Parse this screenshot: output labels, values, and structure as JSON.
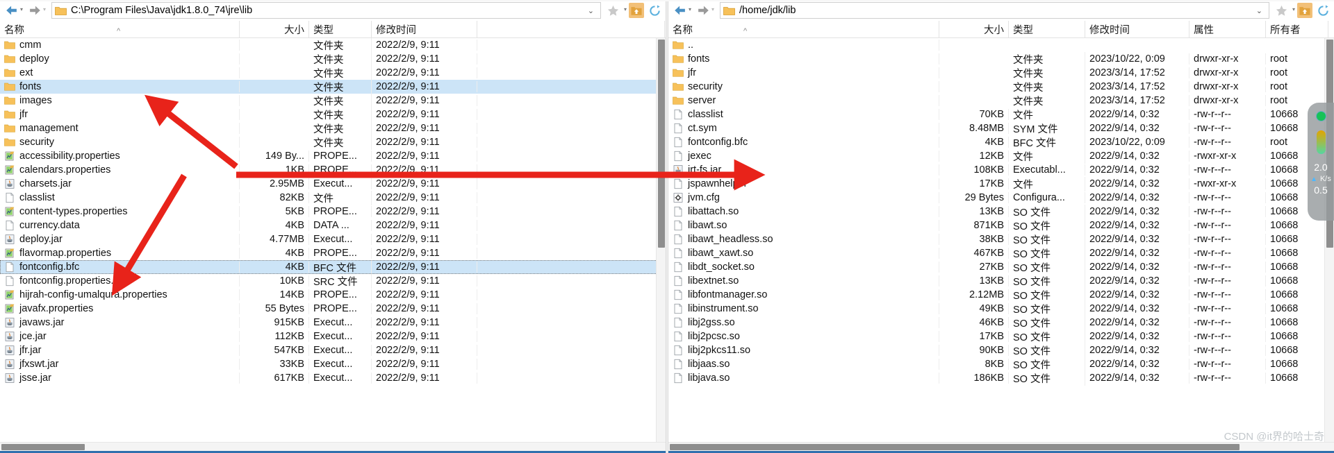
{
  "left": {
    "address": "C:\\Program Files\\Java\\jdk1.8.0_74\\jre\\lib",
    "columns": [
      "名称",
      "大小",
      "类型",
      "修改时间"
    ],
    "rows": [
      {
        "icon": "folder",
        "name": "cmm",
        "size": "",
        "type": "文件夹",
        "time": "2022/2/9, 9:11"
      },
      {
        "icon": "folder",
        "name": "deploy",
        "size": "",
        "type": "文件夹",
        "time": "2022/2/9, 9:11"
      },
      {
        "icon": "folder",
        "name": "ext",
        "size": "",
        "type": "文件夹",
        "time": "2022/2/9, 9:11"
      },
      {
        "icon": "folder",
        "name": "fonts",
        "size": "",
        "type": "文件夹",
        "time": "2022/2/9, 9:11",
        "selected": true
      },
      {
        "icon": "folder",
        "name": "images",
        "size": "",
        "type": "文件夹",
        "time": "2022/2/9, 9:11"
      },
      {
        "icon": "folder",
        "name": "jfr",
        "size": "",
        "type": "文件夹",
        "time": "2022/2/9, 9:11"
      },
      {
        "icon": "folder",
        "name": "management",
        "size": "",
        "type": "文件夹",
        "time": "2022/2/9, 9:11"
      },
      {
        "icon": "folder",
        "name": "security",
        "size": "",
        "type": "文件夹",
        "time": "2022/2/9, 9:11"
      },
      {
        "icon": "properties",
        "name": "accessibility.properties",
        "size": "149 By...",
        "type": "PROPE...",
        "time": "2022/2/9, 9:11"
      },
      {
        "icon": "properties",
        "name": "calendars.properties",
        "size": "1KB",
        "type": "PROPE...",
        "time": "2022/2/9, 9:11"
      },
      {
        "icon": "jar",
        "name": "charsets.jar",
        "size": "2.95MB",
        "type": "Execut...",
        "time": "2022/2/9, 9:11"
      },
      {
        "icon": "file",
        "name": "classlist",
        "size": "82KB",
        "type": "文件",
        "time": "2022/2/9, 9:11"
      },
      {
        "icon": "properties",
        "name": "content-types.properties",
        "size": "5KB",
        "type": "PROPE...",
        "time": "2022/2/9, 9:11"
      },
      {
        "icon": "file",
        "name": "currency.data",
        "size": "4KB",
        "type": "DATA ...",
        "time": "2022/2/9, 9:11"
      },
      {
        "icon": "jar",
        "name": "deploy.jar",
        "size": "4.77MB",
        "type": "Execut...",
        "time": "2022/2/9, 9:11"
      },
      {
        "icon": "properties",
        "name": "flavormap.properties",
        "size": "4KB",
        "type": "PROPE...",
        "time": "2022/2/9, 9:11"
      },
      {
        "icon": "file",
        "name": "fontconfig.bfc",
        "size": "4KB",
        "type": "BFC 文件",
        "time": "2022/2/9, 9:11",
        "selected": true,
        "focused": true
      },
      {
        "icon": "file",
        "name": "fontconfig.properties.src",
        "size": "10KB",
        "type": "SRC 文件",
        "time": "2022/2/9, 9:11"
      },
      {
        "icon": "properties",
        "name": "hijrah-config-umalqura.properties",
        "size": "14KB",
        "type": "PROPE...",
        "time": "2022/2/9, 9:11"
      },
      {
        "icon": "properties",
        "name": "javafx.properties",
        "size": "55 Bytes",
        "type": "PROPE...",
        "time": "2022/2/9, 9:11"
      },
      {
        "icon": "jar",
        "name": "javaws.jar",
        "size": "915KB",
        "type": "Execut...",
        "time": "2022/2/9, 9:11"
      },
      {
        "icon": "jar",
        "name": "jce.jar",
        "size": "112KB",
        "type": "Execut...",
        "time": "2022/2/9, 9:11"
      },
      {
        "icon": "jar",
        "name": "jfr.jar",
        "size": "547KB",
        "type": "Execut...",
        "time": "2022/2/9, 9:11"
      },
      {
        "icon": "jar",
        "name": "jfxswt.jar",
        "size": "33KB",
        "type": "Execut...",
        "time": "2022/2/9, 9:11"
      },
      {
        "icon": "jar",
        "name": "jsse.jar",
        "size": "617KB",
        "type": "Execut...",
        "time": "2022/2/9, 9:11"
      }
    ]
  },
  "right": {
    "address": "/home/jdk/lib",
    "columns": [
      "名称",
      "大小",
      "类型",
      "修改时间",
      "属性",
      "所有者"
    ],
    "rows": [
      {
        "icon": "folder",
        "name": "..",
        "size": "",
        "type": "",
        "time": "",
        "attr": "",
        "owner": ""
      },
      {
        "icon": "folder",
        "name": "fonts",
        "size": "",
        "type": "文件夹",
        "time": "2023/10/22, 0:09",
        "attr": "drwxr-xr-x",
        "owner": "root"
      },
      {
        "icon": "folder",
        "name": "jfr",
        "size": "",
        "type": "文件夹",
        "time": "2023/3/14, 17:52",
        "attr": "drwxr-xr-x",
        "owner": "root"
      },
      {
        "icon": "folder",
        "name": "security",
        "size": "",
        "type": "文件夹",
        "time": "2023/3/14, 17:52",
        "attr": "drwxr-xr-x",
        "owner": "root"
      },
      {
        "icon": "folder",
        "name": "server",
        "size": "",
        "type": "文件夹",
        "time": "2023/3/14, 17:52",
        "attr": "drwxr-xr-x",
        "owner": "root"
      },
      {
        "icon": "file",
        "name": "classlist",
        "size": "70KB",
        "type": "文件",
        "time": "2022/9/14, 0:32",
        "attr": "-rw-r--r--",
        "owner": "10668"
      },
      {
        "icon": "file",
        "name": "ct.sym",
        "size": "8.48MB",
        "type": "SYM 文件",
        "time": "2022/9/14, 0:32",
        "attr": "-rw-r--r--",
        "owner": "10668"
      },
      {
        "icon": "file",
        "name": "fontconfig.bfc",
        "size": "4KB",
        "type": "BFC 文件",
        "time": "2023/10/22, 0:09",
        "attr": "-rw-r--r--",
        "owner": "root"
      },
      {
        "icon": "file",
        "name": "jexec",
        "size": "12KB",
        "type": "文件",
        "time": "2022/9/14, 0:32",
        "attr": "-rwxr-xr-x",
        "owner": "10668"
      },
      {
        "icon": "jar",
        "name": "jrt-fs.jar",
        "size": "108KB",
        "type": "Executabl...",
        "time": "2022/9/14, 0:32",
        "attr": "-rw-r--r--",
        "owner": "10668"
      },
      {
        "icon": "file",
        "name": "jspawnhelper",
        "size": "17KB",
        "type": "文件",
        "time": "2022/9/14, 0:32",
        "attr": "-rwxr-xr-x",
        "owner": "10668"
      },
      {
        "icon": "config",
        "name": "jvm.cfg",
        "size": "29 Bytes",
        "type": "Configura...",
        "time": "2022/9/14, 0:32",
        "attr": "-rw-r--r--",
        "owner": "10668"
      },
      {
        "icon": "file",
        "name": "libattach.so",
        "size": "13KB",
        "type": "SO 文件",
        "time": "2022/9/14, 0:32",
        "attr": "-rw-r--r--",
        "owner": "10668"
      },
      {
        "icon": "file",
        "name": "libawt.so",
        "size": "871KB",
        "type": "SO 文件",
        "time": "2022/9/14, 0:32",
        "attr": "-rw-r--r--",
        "owner": "10668"
      },
      {
        "icon": "file",
        "name": "libawt_headless.so",
        "size": "38KB",
        "type": "SO 文件",
        "time": "2022/9/14, 0:32",
        "attr": "-rw-r--r--",
        "owner": "10668"
      },
      {
        "icon": "file",
        "name": "libawt_xawt.so",
        "size": "467KB",
        "type": "SO 文件",
        "time": "2022/9/14, 0:32",
        "attr": "-rw-r--r--",
        "owner": "10668"
      },
      {
        "icon": "file",
        "name": "libdt_socket.so",
        "size": "27KB",
        "type": "SO 文件",
        "time": "2022/9/14, 0:32",
        "attr": "-rw-r--r--",
        "owner": "10668"
      },
      {
        "icon": "file",
        "name": "libextnet.so",
        "size": "13KB",
        "type": "SO 文件",
        "time": "2022/9/14, 0:32",
        "attr": "-rw-r--r--",
        "owner": "10668"
      },
      {
        "icon": "file",
        "name": "libfontmanager.so",
        "size": "2.12MB",
        "type": "SO 文件",
        "time": "2022/9/14, 0:32",
        "attr": "-rw-r--r--",
        "owner": "10668"
      },
      {
        "icon": "file",
        "name": "libinstrument.so",
        "size": "49KB",
        "type": "SO 文件",
        "time": "2022/9/14, 0:32",
        "attr": "-rw-r--r--",
        "owner": "10668"
      },
      {
        "icon": "file",
        "name": "libj2gss.so",
        "size": "46KB",
        "type": "SO 文件",
        "time": "2022/9/14, 0:32",
        "attr": "-rw-r--r--",
        "owner": "10668"
      },
      {
        "icon": "file",
        "name": "libj2pcsc.so",
        "size": "17KB",
        "type": "SO 文件",
        "time": "2022/9/14, 0:32",
        "attr": "-rw-r--r--",
        "owner": "10668"
      },
      {
        "icon": "file",
        "name": "libj2pkcs11.so",
        "size": "90KB",
        "type": "SO 文件",
        "time": "2022/9/14, 0:32",
        "attr": "-rw-r--r--",
        "owner": "10668"
      },
      {
        "icon": "file",
        "name": "libjaas.so",
        "size": "8KB",
        "type": "SO 文件",
        "time": "2022/9/14, 0:32",
        "attr": "-rw-r--r--",
        "owner": "10668"
      },
      {
        "icon": "file",
        "name": "libjava.so",
        "size": "186KB",
        "type": "SO 文件",
        "time": "2022/9/14, 0:32",
        "attr": "-rw-r--r--",
        "owner": "10668"
      }
    ]
  },
  "net_widget": {
    "up_speed": "2.0",
    "up_unit": "K/s",
    "down_speed": "0.5"
  },
  "watermark": "CSDN @it界的哈士奇",
  "colors": {
    "selection": "#cce4f7",
    "folder": "#f7c15a",
    "annotation": "#e8231a",
    "accent_bottom": "#2f6fad"
  }
}
